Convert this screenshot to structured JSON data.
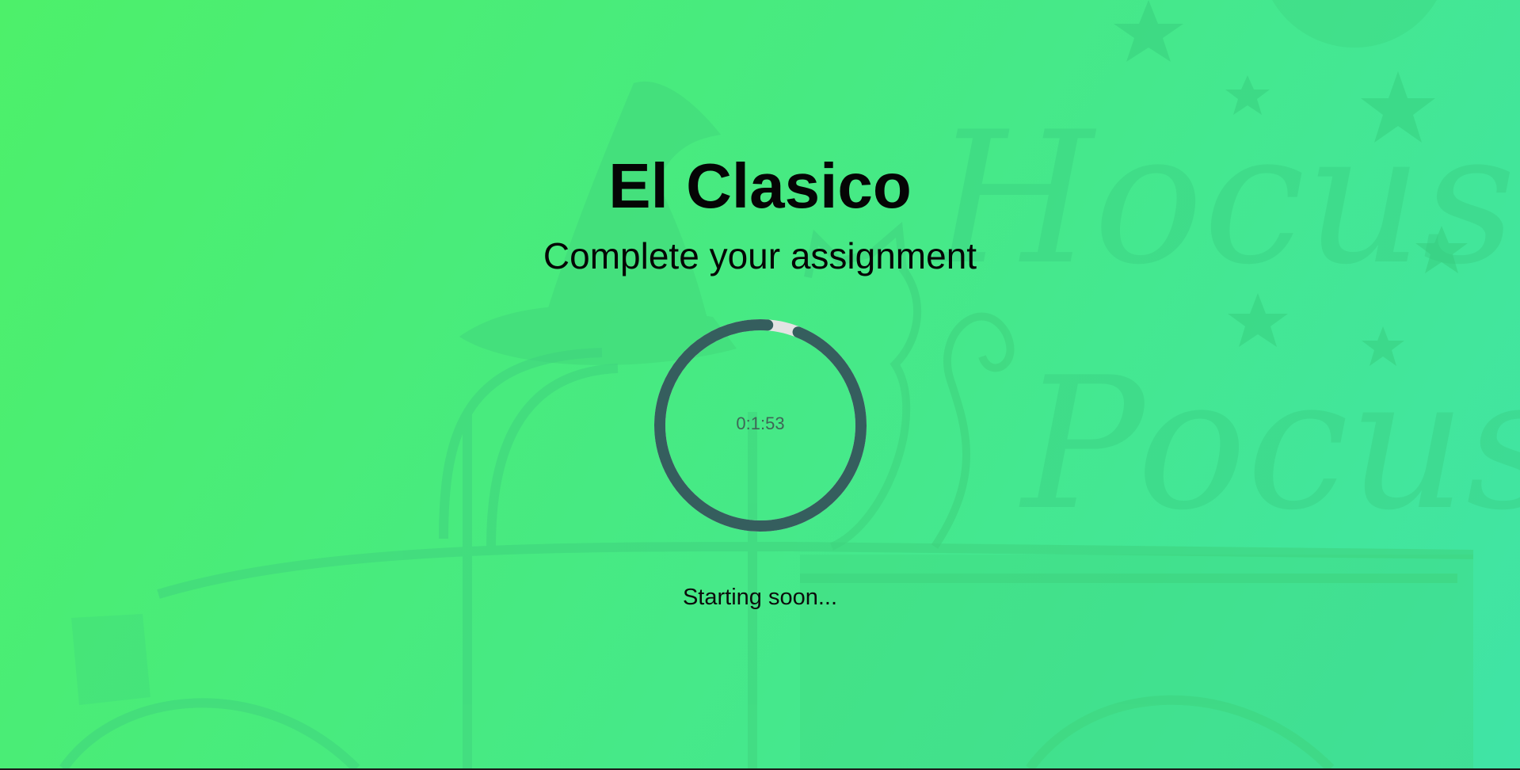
{
  "header": {
    "title": "El Clasico",
    "subtitle": "Complete your assignment"
  },
  "timer": {
    "display": "0:1:53",
    "progress_fraction": 0.95,
    "ring_color": "#355e5e",
    "track_color": "#e3e3e3"
  },
  "status": {
    "text": "Starting soon..."
  },
  "background": {
    "gradient_start": "#4df06a",
    "gradient_end": "#40e4a6",
    "decoration_words": [
      "Hocus",
      "Pocus"
    ]
  }
}
